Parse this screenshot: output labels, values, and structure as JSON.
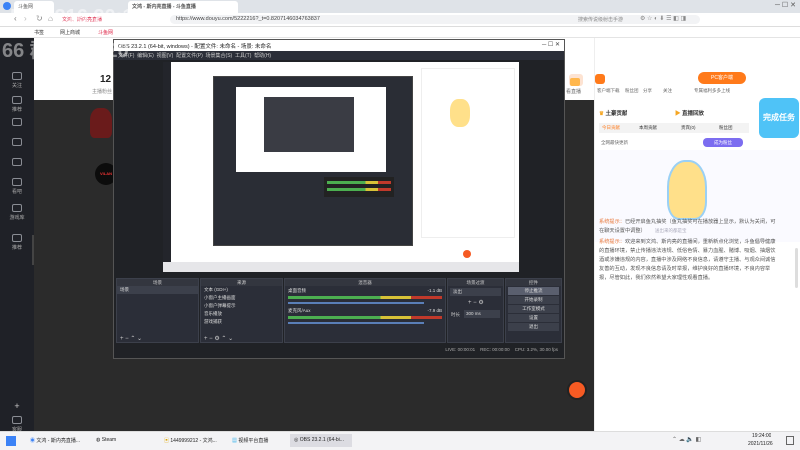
{
  "browser": {
    "tabs": [
      {
        "label": "斗鱼网"
      },
      {
        "label": "文鸿 - 斯内亮直播 - 斗鱼直播"
      },
      {
        "label": "文鸿、斯内亮直播"
      },
      {
        "label": "斗鱼网"
      }
    ],
    "url": "https://www.douyu.com/5222216?_t=0.8207146034763837",
    "search_placeholder": "搜索传说级射击手游",
    "bookmarks": [
      "书签",
      "网上商城",
      "斗鱼网"
    ],
    "watermark": "5222216   20:1",
    "watermark2": "66 群: 642120"
  },
  "sidebar": {
    "items": [
      "关注",
      "推荐",
      "分类",
      "直播",
      "游戏",
      "看吧",
      "游戏库",
      "推荐"
    ],
    "bottom": [
      "客服"
    ]
  },
  "douyu": {
    "fans_num": "12",
    "fans_label": "主播粉丝",
    "badge": "VILAN",
    "top_icons": [
      "粉丝团",
      "分享",
      "看直播",
      "关注"
    ],
    "pc_btn": "PC客户端",
    "pc_sub": "专属福利多多上线",
    "download": "客户端下载"
  },
  "obs": {
    "title": "OBS 23.2.1 (64-bit, windows) - 配置文件: 未命名 - 场景: 未命名",
    "menu": [
      "文件(F)",
      "编辑(E)",
      "视图(V)",
      "配置文件(P)",
      "场景集合(S)",
      "工具(T)",
      "帮助(H)"
    ],
    "scenes_title": "场景",
    "scenes": [
      "场景"
    ],
    "sources_title": "来源",
    "sources": [
      "文本 (GDI+)",
      "小窗户主播画面",
      "小窗户弹幕提示",
      "音乐播放",
      "游戏捕获"
    ],
    "mixer_title": "混音器",
    "mixer": [
      {
        "name": "桌面音频",
        "db": "-1.1 dB"
      },
      {
        "name": "麦克风/Aux",
        "db": "-7.9 dB"
      }
    ],
    "transition_title": "场景过渡",
    "transition": "淡出",
    "duration_label": "时长",
    "duration": "300 ms",
    "controls_title": "控件",
    "controls": [
      "停止推流",
      "开始录制",
      "工作室模式",
      "设置",
      "退出"
    ],
    "status": {
      "live": "LIVE: 00:00:01",
      "rec": "REC: 00:00:00",
      "cpu": "CPU: 3.2%, 30.00 fps"
    }
  },
  "right_panel": {
    "tabs_head": [
      "土豪贡献",
      "直播回放"
    ],
    "sub_tabs": [
      "今日贡献",
      "本周贡献",
      "贵宾(0)",
      "粉丝团"
    ],
    "announcement": "全网最快更新",
    "follow_btn": "成为粉丝",
    "promo_text": "完成任务",
    "mascot_caption": "送出来的都是宝",
    "chat": [
      {
        "tag": "系统提示：",
        "text": "已经开启鱼丸抽奖（鱼丸抽奖可在播放器上显示，默认为关闭，可在聊天设置中调整）"
      },
      {
        "tag": "系统提示：",
        "text": "欢迎来到文鸿、斯内亮的直播间，重新新点化浏览，斗鱼倡导健康的直播环境，禁止传播违法违规、低俗色情、暴力血腥、赌博、吸烟、抽烟饮酒或涉嫌违规的内容，直播中涉及网络不良信息，请遵守主播、与观众间诚信友善的互动，发现不良信息请及时举报，维护良好的直播环境，不良内容举报，尽管如此，我们依然希望大家理性观看直播。"
      }
    ]
  },
  "taskbar": {
    "items": [
      "文鸿 - 斯内亮直播...",
      "Steam",
      "1449999212 - 文鸿...",
      "视频平台直播",
      "OBS 23.2.1 (64-bi..."
    ],
    "time": "19:24:00",
    "date": "2021/11/26"
  },
  "colors": {
    "accent": "#ff7a1a",
    "obs_bg": "#202226",
    "dark": "#2b2b2b"
  }
}
